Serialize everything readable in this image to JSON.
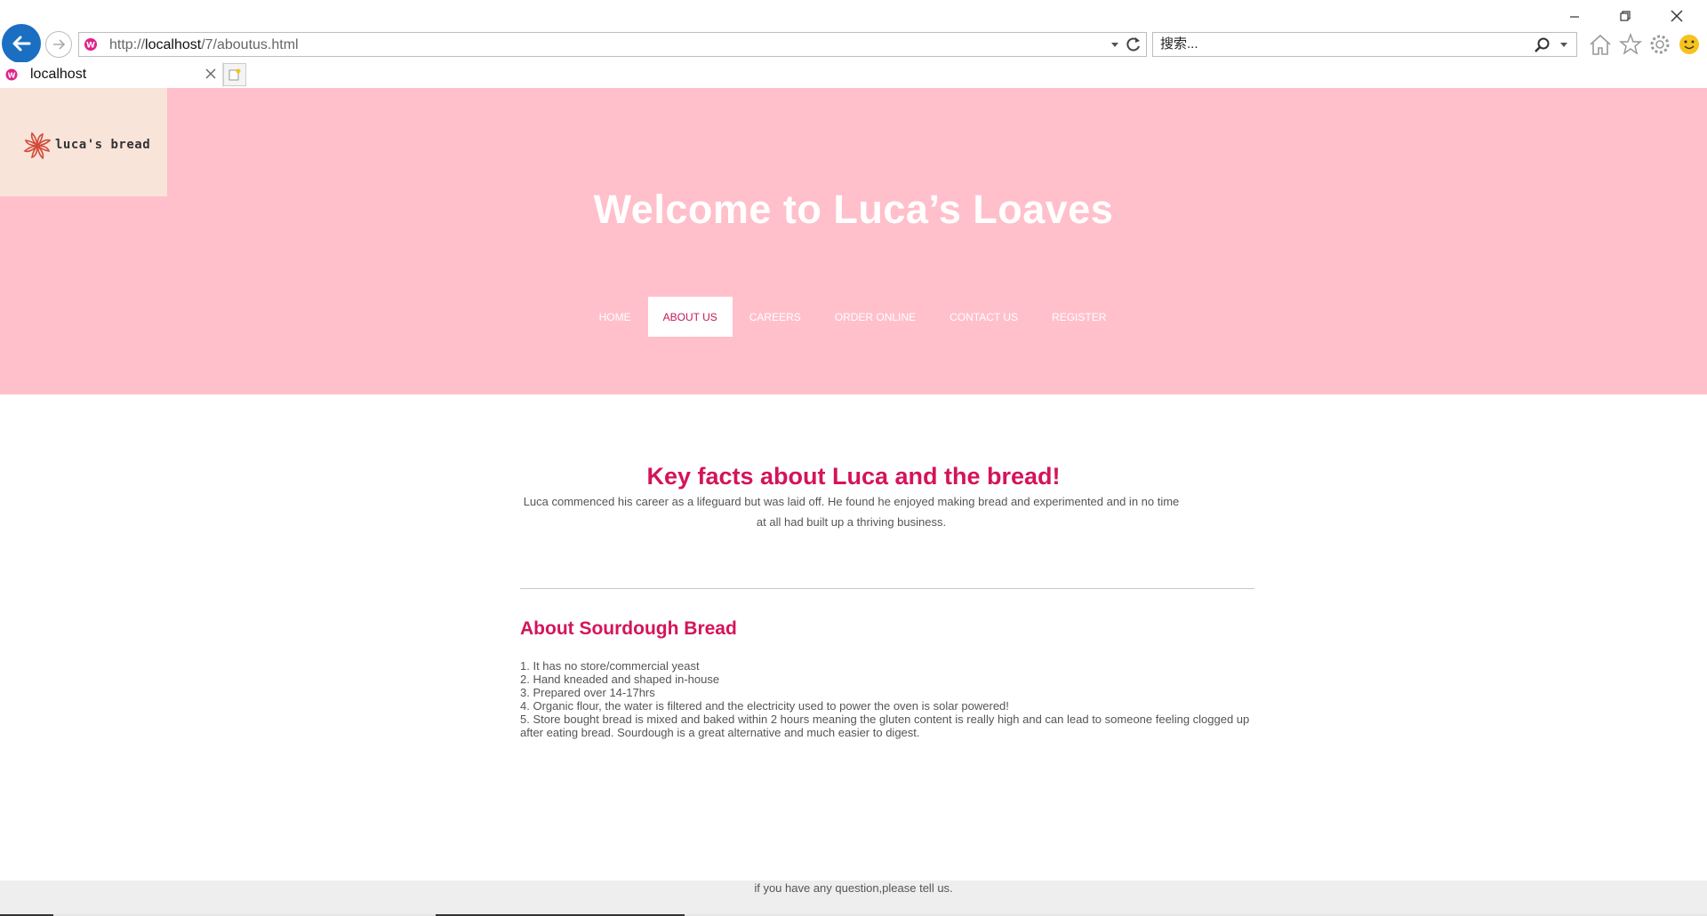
{
  "browser": {
    "url_prefix": "http://",
    "url_host": "localhost",
    "url_path": "/7/aboutus.html",
    "search_placeholder": "搜索...",
    "tab_title": "localhost"
  },
  "site": {
    "logo_text": "luca's bread",
    "welcome": "Welcome to Luca’s Loaves",
    "nav": [
      {
        "label": "HOME"
      },
      {
        "label": "ABOUT US"
      },
      {
        "label": "CAREERS"
      },
      {
        "label": "ORDER ONLINE"
      },
      {
        "label": "CONTACT US"
      },
      {
        "label": "REGISTER"
      }
    ],
    "active_nav": "ABOUT US"
  },
  "content": {
    "key_facts_title": "Key facts about Luca and the bread!",
    "key_facts_text": "Luca commenced his career as a lifeguard but was laid off. He found he enjoyed making bread and experimented and in no time at all had built up a thriving business.",
    "sourdough_title": "About Sourdough Bread",
    "sourdough_points": [
      "1. It has no store/commercial yeast",
      "2. Hand kneaded and shaped in-house",
      "3. Prepared over 14-17hrs",
      "4. Organic flour, the water is filtered and the electricity used to power the oven is solar powered!",
      "5. Store bought bread is mixed and baked within 2 hours meaning the gluten content is really high and can lead to someone feeling clogged up after eating bread. Sourdough is a great alternative and much easier to digest."
    ]
  },
  "footer": {
    "text": "if you have any question,please tell us."
  },
  "colors": {
    "header_bg": "#ffc0cb",
    "logo_bg": "#f9e4da",
    "accent": "#d4145a",
    "footer_bg": "#eeeeee"
  }
}
